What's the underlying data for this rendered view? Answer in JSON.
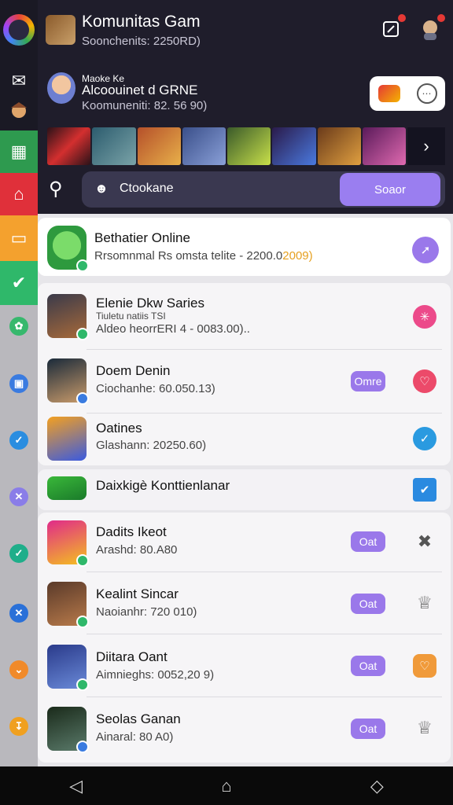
{
  "header": {
    "title": "Komunitas Gam",
    "subtitle": "Soonchenits: 2250RD)"
  },
  "group": {
    "line1": "Maoke Ke",
    "line2": "Alcoouinet d GRNE",
    "line3": "Koomuneniti: 82. 56 90)"
  },
  "search": {
    "user_icon": "user-icon",
    "text": "Ctookane",
    "button_label": "Soaor"
  },
  "featured": {
    "title": "Bethatier Online",
    "subtitle": "Rrsomnmal Rs omsta telite - 2200.0",
    "subtitle_highlight": "2009)"
  },
  "list1": [
    {
      "title": "Elenie Dkw Saries",
      "subtitle_top": "Tiuletu natiis TSI",
      "subtitle": "Aldeo heorrERI 4 - 0083.00)..",
      "pill": ""
    },
    {
      "title": "Doem Denin",
      "subtitle": "Ciochanhe: 60.050.13)",
      "pill": "Omre"
    },
    {
      "title": "Oatines",
      "subtitle": "Glashann: 20250.60)",
      "pill": ""
    }
  ],
  "section_header": {
    "title": "Daixkigè Konttienlanar"
  },
  "list2": [
    {
      "title": "Dadits Ikeot",
      "subtitle": "Arashd: 80.A80",
      "pill": "Oat"
    },
    {
      "title": "Kealint Sincar",
      "subtitle": "Naoianhr: 720 010)",
      "pill": "Oat"
    },
    {
      "title": "Diitara Oant",
      "subtitle": "Aimnieghs: 0052,20 9)",
      "pill": "Oat"
    },
    {
      "title": "Seolas Ganan",
      "subtitle": "Ainaral: 80 A0)",
      "pill": "Oat"
    }
  ],
  "colors": {
    "accent": "#9a78ea",
    "header_bg": "#1f1d2b"
  }
}
